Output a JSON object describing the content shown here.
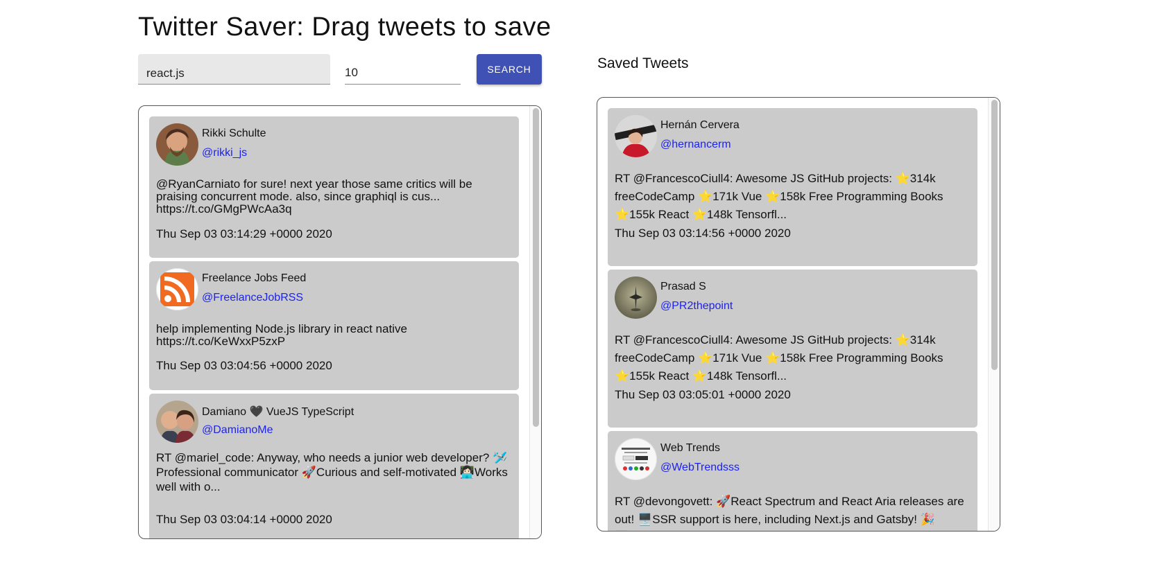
{
  "app": {
    "title": "Twitter Saver: Drag tweets to save"
  },
  "search": {
    "query": "react.js",
    "count": "10",
    "button_label": "SEARCH"
  },
  "colors": {
    "accent": "#3f51b5",
    "card": "#cbcbcb",
    "handle": "#1c22f0"
  },
  "results": [
    {
      "name": "Rikki Schulte",
      "handle": "@rikki_js",
      "text": "@RyanCarniato for sure! next year those same critics will be praising concurrent mode. also, since graphiql is cus... https://t.co/GMgPWcAa3q",
      "date": "Thu Sep 03 03:14:29 +0000 2020",
      "avatar_icon": "person-avatar-icon"
    },
    {
      "name": "Freelance Jobs Feed",
      "handle": "@FreelanceJobRSS",
      "text": "help implementing Node.js library in react native https://t.co/KeWxxP5zxP",
      "date": "Thu Sep 03 03:04:56 +0000 2020",
      "avatar_icon": "rss-icon"
    },
    {
      "name": "Damiano 🖤 VueJS TypeScript",
      "handle": "@DamianoMe",
      "text": "RT @mariel_code: Anyway, who needs a junior web developer? 🛩️ Professional communicator 🚀Curious and self-motivated 👩🏻‍💻Works well with o...",
      "date": "Thu Sep 03 03:04:14 +0000 2020",
      "avatar_icon": "person-avatar-icon"
    }
  ],
  "saved": {
    "heading": "Saved Tweets",
    "items": [
      {
        "name": "Hernán Cervera",
        "handle": "@hernancerm",
        "text": "RT @FrancescoCiull4: Awesome JS GitHub projects: ⭐️314k freeCodeCamp ⭐️171k Vue ⭐️158k Free Programming Books ⭐️155k React ⭐️148k Tensorfl...",
        "date": "Thu Sep 03 03:14:56 +0000 2020",
        "avatar_icon": "person-avatar-icon"
      },
      {
        "name": "Prasad S",
        "handle": "@PR2thepoint",
        "text": "RT @FrancescoCiull4: Awesome JS GitHub projects: ⭐️314k freeCodeCamp ⭐️171k Vue ⭐️158k Free Programming Books ⭐️155k React ⭐️148k Tensorfl...",
        "date": "Thu Sep 03 03:05:01 +0000 2020",
        "avatar_icon": "spinning-top-avatar-icon"
      },
      {
        "name": "Web Trends",
        "handle": "@WebTrendsss",
        "text": "RT @devongovett: 🚀React Spectrum and React Aria releases are out! 🖥️SSR support is here, including Next.js and Gatsby! 🎉✅New Checkbox Gr...",
        "date": "",
        "avatar_icon": "website-thumbnail-avatar-icon"
      }
    ]
  }
}
